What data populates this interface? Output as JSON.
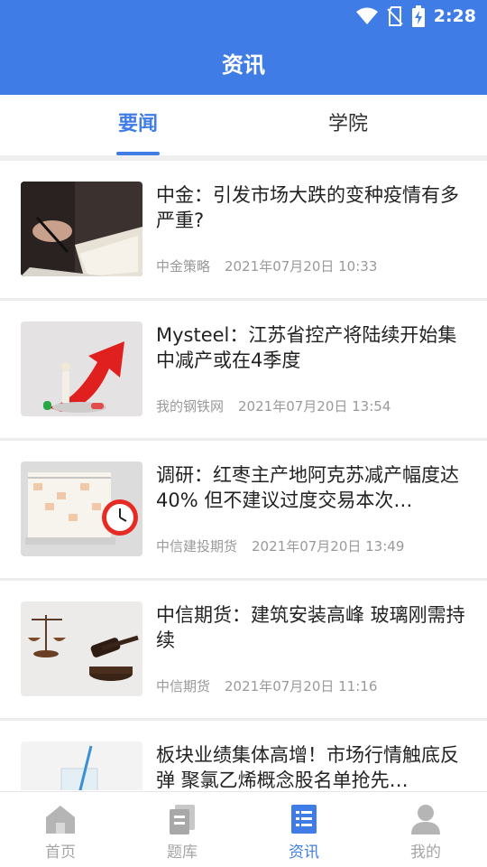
{
  "status_bar": {
    "time": "2:28"
  },
  "header": {
    "title": "资讯"
  },
  "tabs": [
    {
      "label": "要闻",
      "active": true
    },
    {
      "label": "学院",
      "active": false
    }
  ],
  "news": [
    {
      "title": "中金：引发市场大跌的变种疫情有多严重?",
      "source": "中金策略",
      "date": "2021年07月20日 10:33",
      "image": "writing-hand"
    },
    {
      "title": "Mysteel：江苏省控产将陆续开始集中减产或在4季度",
      "source": "我的钢铁网",
      "date": "2021年07月20日 13:54",
      "image": "red-arrow"
    },
    {
      "title": "调研：红枣主产地阿克苏减产幅度达40% 但不建议过度交易本次…",
      "source": "中信建投期货",
      "date": "2021年07月20日 13:49",
      "image": "calendar-clock"
    },
    {
      "title": "中信期货：建筑安装高峰 玻璃刚需持续",
      "source": "中信期货",
      "date": "2021年07月20日 11:16",
      "image": "scales-gavel"
    },
    {
      "title": "板块业绩集体高增！市场行情触底反弹 聚氯乙烯概念股名单抢先…",
      "source": "",
      "date": "",
      "image": "lab-glass"
    }
  ],
  "bottom_nav": [
    {
      "label": "首页",
      "icon": "home-icon",
      "active": false
    },
    {
      "label": "题库",
      "icon": "question-bank-icon",
      "active": false
    },
    {
      "label": "资讯",
      "icon": "news-icon",
      "active": true
    },
    {
      "label": "我的",
      "icon": "profile-icon",
      "active": false
    }
  ],
  "colors": {
    "primary": "#3f7ce5",
    "inactive": "#a5a5a5",
    "text": "#222222",
    "meta": "#9a9a9a"
  }
}
